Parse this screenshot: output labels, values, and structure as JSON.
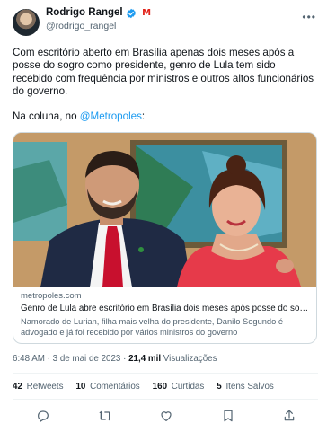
{
  "author": {
    "display_name": "Rodrigo Rangel",
    "handle": "@rodrigo_rangel",
    "badge_letter": "M"
  },
  "tweet": {
    "paragraph1": "Com escritório aberto em Brasília apenas dois meses após a posse do sogro como presidente, genro de Lula tem sido recebido com frequência por ministros e outros altos funcionários do governo.",
    "paragraph2_prefix": "Na coluna, no ",
    "paragraph2_mention": "@Metropoles",
    "paragraph2_suffix": ":"
  },
  "card": {
    "domain": "metropoles.com",
    "title": "Genro de Lula abre escritório em Brasília dois meses após posse do sogro | M...",
    "description": "Namorado de Lurian, filha mais velha do presidente, Danilo Segundo é advogado e já foi recebido por vários ministros do governo"
  },
  "meta": {
    "timestamp": "6:48 AM · 3 de mai de 2023",
    "separator": " · ",
    "views_count": "21,4 mil",
    "views_label": "Visualizações"
  },
  "stats": {
    "retweets_count": "42",
    "retweets_label": "Retweets",
    "comments_count": "10",
    "comments_label": "Comentários",
    "likes_count": "160",
    "likes_label": "Curtidas",
    "saved_count": "5",
    "saved_label": "Itens Salvos"
  },
  "icons": {
    "verified": "verified-badge-icon",
    "reply": "reply-icon",
    "retweet": "retweet-icon",
    "like": "heart-icon",
    "bookmark": "bookmark-icon",
    "share": "share-icon",
    "more": "more-options-icon"
  },
  "colors": {
    "accent": "#1d9bf0",
    "badge_red": "#e2231a",
    "muted_text": "#536471",
    "border": "#cfd9de"
  }
}
